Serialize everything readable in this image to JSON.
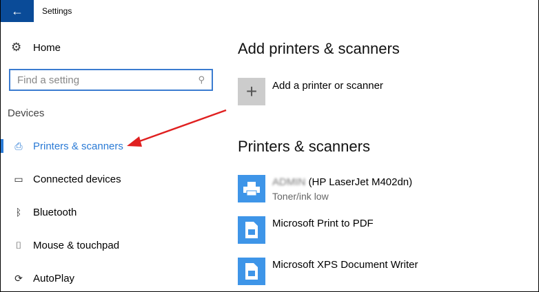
{
  "window": {
    "title": "Settings",
    "back_icon": "←"
  },
  "sidebar": {
    "home": "Home",
    "search_placeholder": "Find a setting",
    "section": "Devices",
    "items": [
      {
        "label": "Printers & scanners",
        "icon": "printer-icon",
        "glyph": "⎙"
      },
      {
        "label": "Connected devices",
        "icon": "connected-devices-icon",
        "glyph": "▭"
      },
      {
        "label": "Bluetooth",
        "icon": "bluetooth-icon",
        "glyph": "ᛒ"
      },
      {
        "label": "Mouse & touchpad",
        "icon": "mouse-icon",
        "glyph": "⌷"
      },
      {
        "label": "AutoPlay",
        "icon": "autoplay-icon",
        "glyph": "⟳"
      }
    ]
  },
  "main": {
    "add_heading": "Add printers & scanners",
    "add_label": "Add a printer or scanner",
    "list_heading": "Printers & scanners",
    "printers": [
      {
        "name_blurred": "ADMIN",
        "name": "(HP LaserJet M402dn)",
        "status": "Toner/ink low"
      },
      {
        "name": "Microsoft Print to PDF"
      },
      {
        "name": "Microsoft XPS Document Writer"
      }
    ]
  },
  "colors": {
    "accent": "#2a7ad5",
    "titlebar": "#0a4b98",
    "annotation": "#e02020"
  }
}
